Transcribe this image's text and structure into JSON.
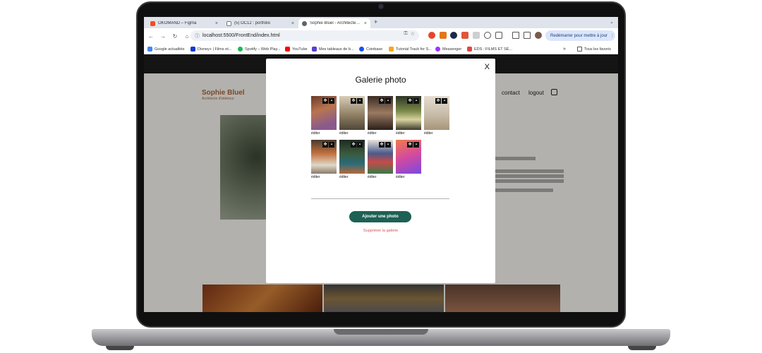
{
  "browser": {
    "tabs": [
      {
        "label": "OKOMAND – Figma",
        "color": "#f24e1e"
      },
      {
        "label": "(5) OC12 : portfolio",
        "color": "#8a8a8a"
      },
      {
        "label": "Sophie Bluel - Architecte d'in",
        "color": "#5f6368"
      }
    ],
    "url": "localhost:5500/FrontEnd/index.html",
    "relaunch_label": "Redémarrer pour mettre à jour",
    "bookmarks": [
      {
        "label": "Google actualités",
        "color": "#4285f4"
      },
      {
        "label": "Disney+ | Films et...",
        "color": "#113ccf"
      },
      {
        "label": "Spotify – Web Play...",
        "color": "#1db954"
      },
      {
        "label": "YouTube",
        "color": "#ff0000"
      },
      {
        "label": "Mes tableaux de b...",
        "color": "#5b3fd1"
      },
      {
        "label": "Coinbase",
        "color": "#1652f0"
      },
      {
        "label": "Tutorial Track for S...",
        "color": "#f5a623"
      },
      {
        "label": "Messenger",
        "color": "#a033ff"
      },
      {
        "label": "EDS : FILMS ET SÉ...",
        "color": "#e04545"
      }
    ],
    "bookmarks_more": "»",
    "all_bookmarks": "Tous les favoris"
  },
  "site": {
    "logo_title": "Sophie Bluel",
    "logo_subtitle": "Architecte d'intérieur",
    "nav_contact": "contact",
    "nav_logout": "logout"
  },
  "modal": {
    "close": "X",
    "title": "Galerie photo",
    "thumbs": [
      {
        "caption": "éditer",
        "bg": "linear-gradient(160deg,#6a3a2a,#b8754f 40%,#8a5a8c 80%)"
      },
      {
        "caption": "éditer",
        "bg": "linear-gradient(180deg,#d8cdb8,#8a7a5f 60%,#4e4638)"
      },
      {
        "caption": "éditer",
        "bg": "linear-gradient(180deg,#3a2c24,#9a7a62 50%,#2a1f1a)"
      },
      {
        "caption": "éditer",
        "bg": "linear-gradient(180deg,#2c3424,#7c8a4a 45%,#d8d2a0 70%,#3a3a2a)"
      },
      {
        "caption": "éditer",
        "bg": "linear-gradient(180deg,#e6ded2,#c4b8a4 60%,#a89478)"
      },
      {
        "caption": "éditer",
        "bg": "linear-gradient(180deg,#4a3a2c,#c2703e 40%,#e0d8c8 75%,#8a7a6a)"
      },
      {
        "caption": "éditer",
        "bg": "linear-gradient(180deg,#1e2a22,#3a5a3a 40%,#2a6a7a 70%,#b86a3a)"
      },
      {
        "caption": "éditer",
        "bg": "linear-gradient(180deg,#e8e2dc,#4a5a8a 40%,#c84a4a 65%,#3a7a4a)"
      },
      {
        "caption": "éditer",
        "bg": "linear-gradient(160deg,#f07a4a,#d24aa0 50%,#7a4ae0)"
      }
    ],
    "add_label": "Ajouter une photo",
    "delete_label": "Supprimer la galerie"
  },
  "colors": {
    "accent": "#1d6154",
    "brand": "#b1663c",
    "danger": "#d65353"
  }
}
